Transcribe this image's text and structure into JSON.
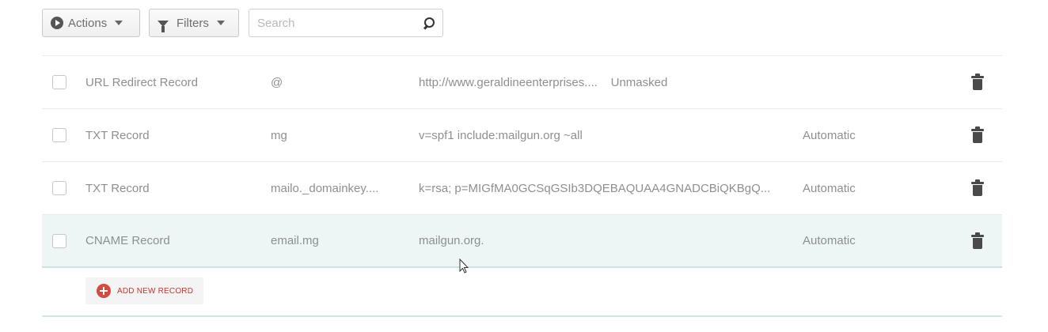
{
  "toolbar": {
    "actions_label": "Actions",
    "filters_label": "Filters",
    "search_placeholder": "Search"
  },
  "records": [
    {
      "type": "URL Redirect Record",
      "host": "@",
      "value": "http://www.geraldineenterprises....",
      "extra": "Unmasked",
      "ttl": ""
    },
    {
      "type": "TXT Record",
      "host": "mg",
      "value": "v=spf1 include:mailgun.org ~all",
      "extra": "",
      "ttl": "Automatic"
    },
    {
      "type": "TXT Record",
      "host": "mailo._domainkey....",
      "value": "k=rsa; p=MIGfMA0GCSqGSIb3DQEBAQUAA4GNADCBiQKBgQ...",
      "extra": "",
      "ttl": "Automatic"
    },
    {
      "type": "CNAME Record",
      "host": "email.mg",
      "value": "mailgun.org.",
      "extra": "",
      "ttl": "Automatic"
    }
  ],
  "add_record_label": "ADD NEW RECORD",
  "colors": {
    "accent": "#d24b3e",
    "highlight_row": "#eef5f5"
  },
  "icons": [
    "play-circle-icon",
    "funnel-icon",
    "search-icon",
    "trash-icon",
    "plus-circle-icon",
    "mouse-cursor-icon"
  ]
}
